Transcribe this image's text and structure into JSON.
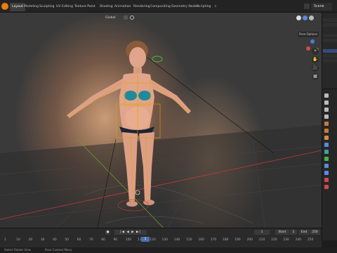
{
  "topbar": {
    "tabs": [
      {
        "label": "Layout",
        "active": true
      },
      {
        "label": "Modeling"
      },
      {
        "label": "Sculpting"
      },
      {
        "label": "UV Editing"
      },
      {
        "label": "Texture Paint"
      },
      {
        "label": "Shading"
      },
      {
        "label": "Animation"
      },
      {
        "label": "Rendering"
      },
      {
        "label": "Compositing"
      },
      {
        "label": "Geometry Nodes"
      },
      {
        "label": "Scripting"
      },
      {
        "label": "+"
      }
    ],
    "scene_label": "Scene"
  },
  "viewport": {
    "transform_orientation": "Global",
    "pose_options_label": "Pose Options",
    "nav_controls": [
      "+",
      "✋",
      "🎥",
      "▦"
    ]
  },
  "timeline": {
    "current_frame": "1",
    "start_label": "Start",
    "start_value": "1",
    "end_label": "End",
    "end_value": "250",
    "frame_numbers": [
      "1",
      "10",
      "20",
      "30",
      "40",
      "50",
      "60",
      "70",
      "80",
      "90",
      "100",
      "110",
      "120",
      "130",
      "140",
      "150",
      "160",
      "170",
      "180",
      "190",
      "200",
      "210",
      "220",
      "230",
      "240",
      "250"
    ]
  },
  "statusbar": {
    "left_hint": "Select",
    "middle_hint": "Rotate View",
    "right_hint": "Pose Context Menu"
  },
  "colors": {
    "accent": "#4772b3",
    "armature": "#e5a100",
    "axis_red": "#c23a3a",
    "axis_green": "#6e9b2a"
  }
}
